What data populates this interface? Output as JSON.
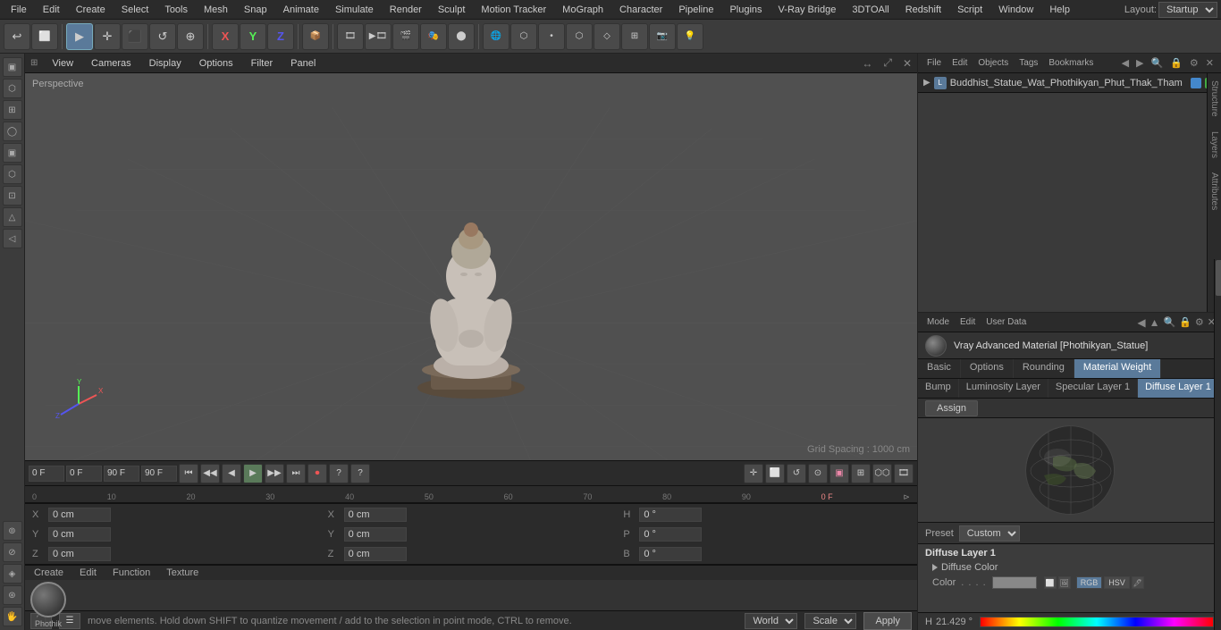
{
  "app": {
    "title": "Cinema 4D"
  },
  "menu": {
    "items": [
      "File",
      "Edit",
      "Create",
      "Select",
      "Tools",
      "Mesh",
      "Snap",
      "Animate",
      "Simulate",
      "Render",
      "Sculpt",
      "Motion Tracker",
      "MoGraph",
      "Character",
      "Pipeline",
      "Plugins",
      "V-Ray Bridge",
      "3DTOAll",
      "Redshift",
      "Script",
      "Window",
      "Help"
    ]
  },
  "layout": {
    "label": "Layout:",
    "value": "Startup"
  },
  "viewport": {
    "label": "Perspective",
    "grid_info": "Grid Spacing : 1000 cm",
    "menus": [
      "View",
      "Cameras",
      "Display",
      "Options",
      "Filter",
      "Panel"
    ]
  },
  "timeline": {
    "frame_start": "0 F",
    "frame_end": "90 F",
    "current_frame": "0 F",
    "input1": "0 F",
    "input2": "90 F",
    "input3": "90 F",
    "marks": [
      "0",
      "10",
      "20",
      "30",
      "40",
      "50",
      "60",
      "70",
      "80",
      "90"
    ]
  },
  "coord_bar": {
    "x_label": "X",
    "y_label": "Y",
    "z_label": "Z",
    "x_pos": "0 cm",
    "y_pos": "0 cm",
    "z_pos": "0 cm",
    "x_size": "0 cm",
    "y_size": "0 cm",
    "z_size": "0 cm",
    "h_val": "0 °",
    "p_val": "0 °",
    "b_val": "0 °",
    "col1_header": "",
    "col2_header": "X",
    "col3_header": "H"
  },
  "status_bar": {
    "text": "move elements. Hold down SHIFT to quantize movement / add to the selection in point mode, CTRL to remove.",
    "world_label": "World",
    "scale_label": "Scale",
    "apply_label": "Apply"
  },
  "material_panel": {
    "name": "Phothik",
    "label": "Phothik"
  },
  "func_bar": {
    "items": [
      "Create",
      "Edit",
      "Function",
      "Texture"
    ]
  },
  "right_panel": {
    "top_tabs": [
      "File",
      "Edit",
      "Objects",
      "Tags",
      "Bookmarks"
    ],
    "object_name": "Buddhist_Statue_Wat_Phothikyan_Phut_Thak_Tham",
    "vtabs": [
      "Structure",
      "Layers",
      "Attributes"
    ],
    "attr": {
      "mode_label": "Mode",
      "edit_label": "Edit",
      "user_data_label": "User Data",
      "material_name": "Vray Advanced Material [Phothikyan_Statue]",
      "tabs": [
        "Basic",
        "Options",
        "Rounding",
        "Material Weight"
      ],
      "subtabs": [
        "Bump",
        "Luminosity Layer",
        "Specular Layer 1",
        "Diffuse Layer 1"
      ],
      "assign_label": "Assign",
      "preset_label": "Preset",
      "preset_value": "Custom",
      "diffuse_layer_title": "Diffuse Layer 1",
      "diffuse_color_title": "Diffuse Color",
      "color_label": "Color",
      "color_dots": ".....",
      "h_label": "H",
      "h_value": "21.429 °"
    }
  }
}
